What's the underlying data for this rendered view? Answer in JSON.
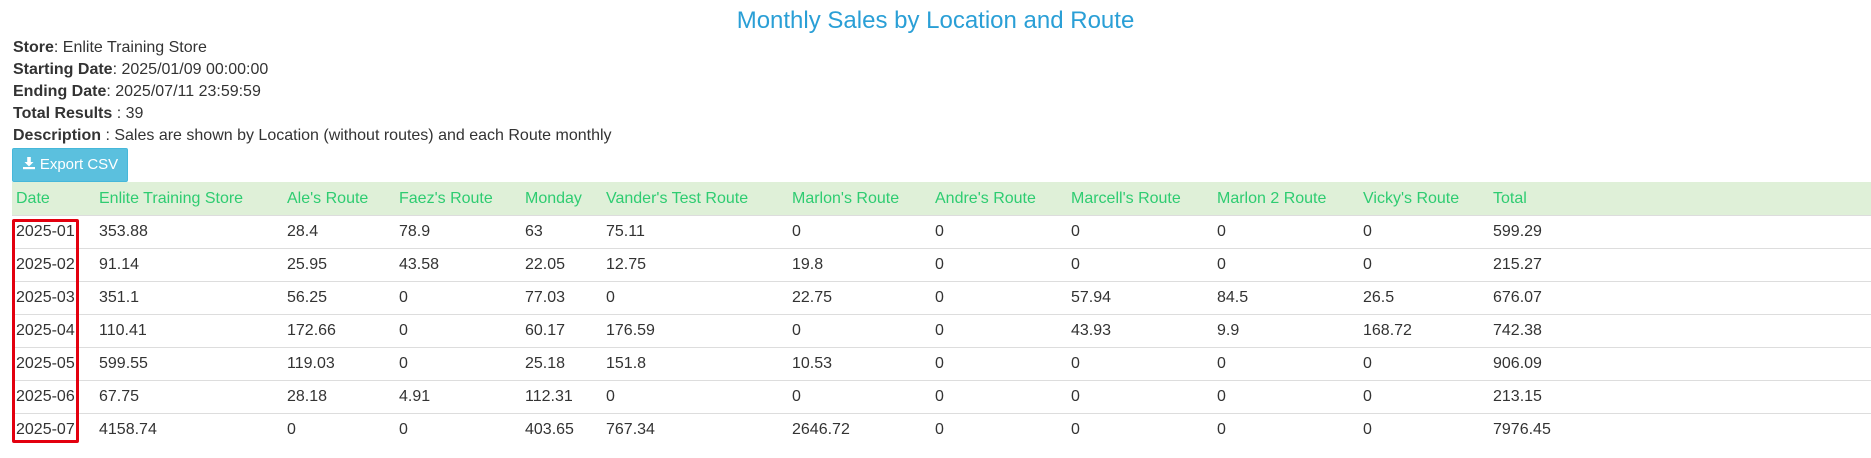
{
  "report": {
    "title": "Monthly Sales by Location and Route",
    "store_label": "Store",
    "store_value": ": Enlite Training Store",
    "start_label": "Starting Date",
    "start_value": ": 2025/01/09 00:00:00",
    "end_label": "Ending Date",
    "end_value": ": 2025/07/11 23:59:59",
    "total_label": "Total Results",
    "total_value": " : 39",
    "description_label": "Description",
    "description_value": " : Sales are shown by Location (without routes) and each Route monthly"
  },
  "toolbar": {
    "export_label": "Export CSV",
    "export_icon": "download-icon"
  },
  "table": {
    "headers": [
      "Date",
      "Enlite Training Store",
      "Ale's Route",
      "Faez's Route",
      "Monday",
      "Vander's Test Route",
      "Marlon's Route",
      "Andre's Route",
      "Marcell's Route",
      "Marlon 2 Route",
      "Vicky's Route",
      "Total"
    ],
    "rows": [
      [
        "2025-01",
        "353.88",
        "28.4",
        "78.9",
        "63",
        "75.11",
        "0",
        "0",
        "0",
        "0",
        "0",
        "599.29"
      ],
      [
        "2025-02",
        "91.14",
        "25.95",
        "43.58",
        "22.05",
        "12.75",
        "19.8",
        "0",
        "0",
        "0",
        "0",
        "215.27"
      ],
      [
        "2025-03",
        "351.1",
        "56.25",
        "0",
        "77.03",
        "0",
        "22.75",
        "0",
        "57.94",
        "84.5",
        "26.5",
        "676.07"
      ],
      [
        "2025-04",
        "110.41",
        "172.66",
        "0",
        "60.17",
        "176.59",
        "0",
        "0",
        "43.93",
        "9.9",
        "168.72",
        "742.38"
      ],
      [
        "2025-05",
        "599.55",
        "119.03",
        "0",
        "25.18",
        "151.8",
        "10.53",
        "0",
        "0",
        "0",
        "0",
        "906.09"
      ],
      [
        "2025-06",
        "67.75",
        "28.18",
        "4.91",
        "112.31",
        "0",
        "0",
        "0",
        "0",
        "0",
        "0",
        "213.15"
      ],
      [
        "2025-07",
        "4158.74",
        "0",
        "0",
        "403.65",
        "767.34",
        "2646.72",
        "0",
        "0",
        "0",
        "0",
        "7976.45"
      ]
    ]
  },
  "colors": {
    "title": "#2a9fd6",
    "header_text": "#2ecc71",
    "header_bg": "#dff0d8",
    "button_bg": "#5bc0de",
    "highlight": "#e3000f"
  }
}
